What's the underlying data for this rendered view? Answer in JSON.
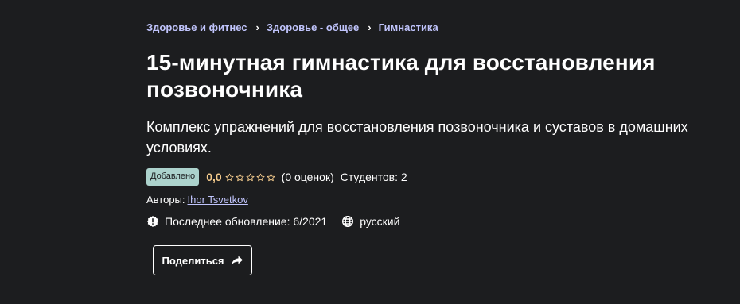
{
  "breadcrumb": {
    "items": [
      {
        "label": "Здоровье и фитнес"
      },
      {
        "label": "Здоровье - общее"
      },
      {
        "label": "Гимнастика"
      }
    ],
    "separator": "›"
  },
  "course": {
    "title": "15-минутная гимнастика для восстановления позвоночника",
    "subtitle": "Комплекс упражнений для восстановления позвоночника и суставов в домашних условиях.",
    "badge": "Добавлено",
    "rating_value": "0,0",
    "rating_stars": 0,
    "rating_max": 5,
    "rating_count": "(0 оценок)",
    "students": "Студентов: 2",
    "authors_label": "Авторы:",
    "author_name": "Ihor Tsvetkov",
    "last_update": "Последнее обновление: 6/2021",
    "language": "русский"
  },
  "share_button": {
    "label": "Поделиться"
  },
  "icons": {
    "update": "alert-badge-icon",
    "language": "globe-icon",
    "share": "share-arrow-icon",
    "star": "star-outline-icon"
  },
  "colors": {
    "background": "#1c1d1f",
    "link": "#c0c4fc",
    "rating": "#f3ca8c",
    "badge_bg": "#acd2cc",
    "text": "#ffffff"
  }
}
